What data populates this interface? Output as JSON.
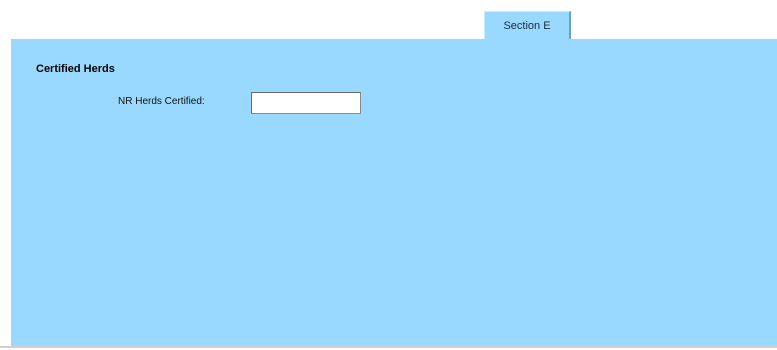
{
  "tabs": [
    {
      "label": "Section E",
      "active": true
    }
  ],
  "panel": {
    "title": "Certified Herds",
    "fields": [
      {
        "label": "NR Herds Certified:",
        "value": "",
        "placeholder": ""
      }
    ]
  },
  "colors": {
    "panel_background": "#99d9ff",
    "page_background": "#ffffff"
  }
}
